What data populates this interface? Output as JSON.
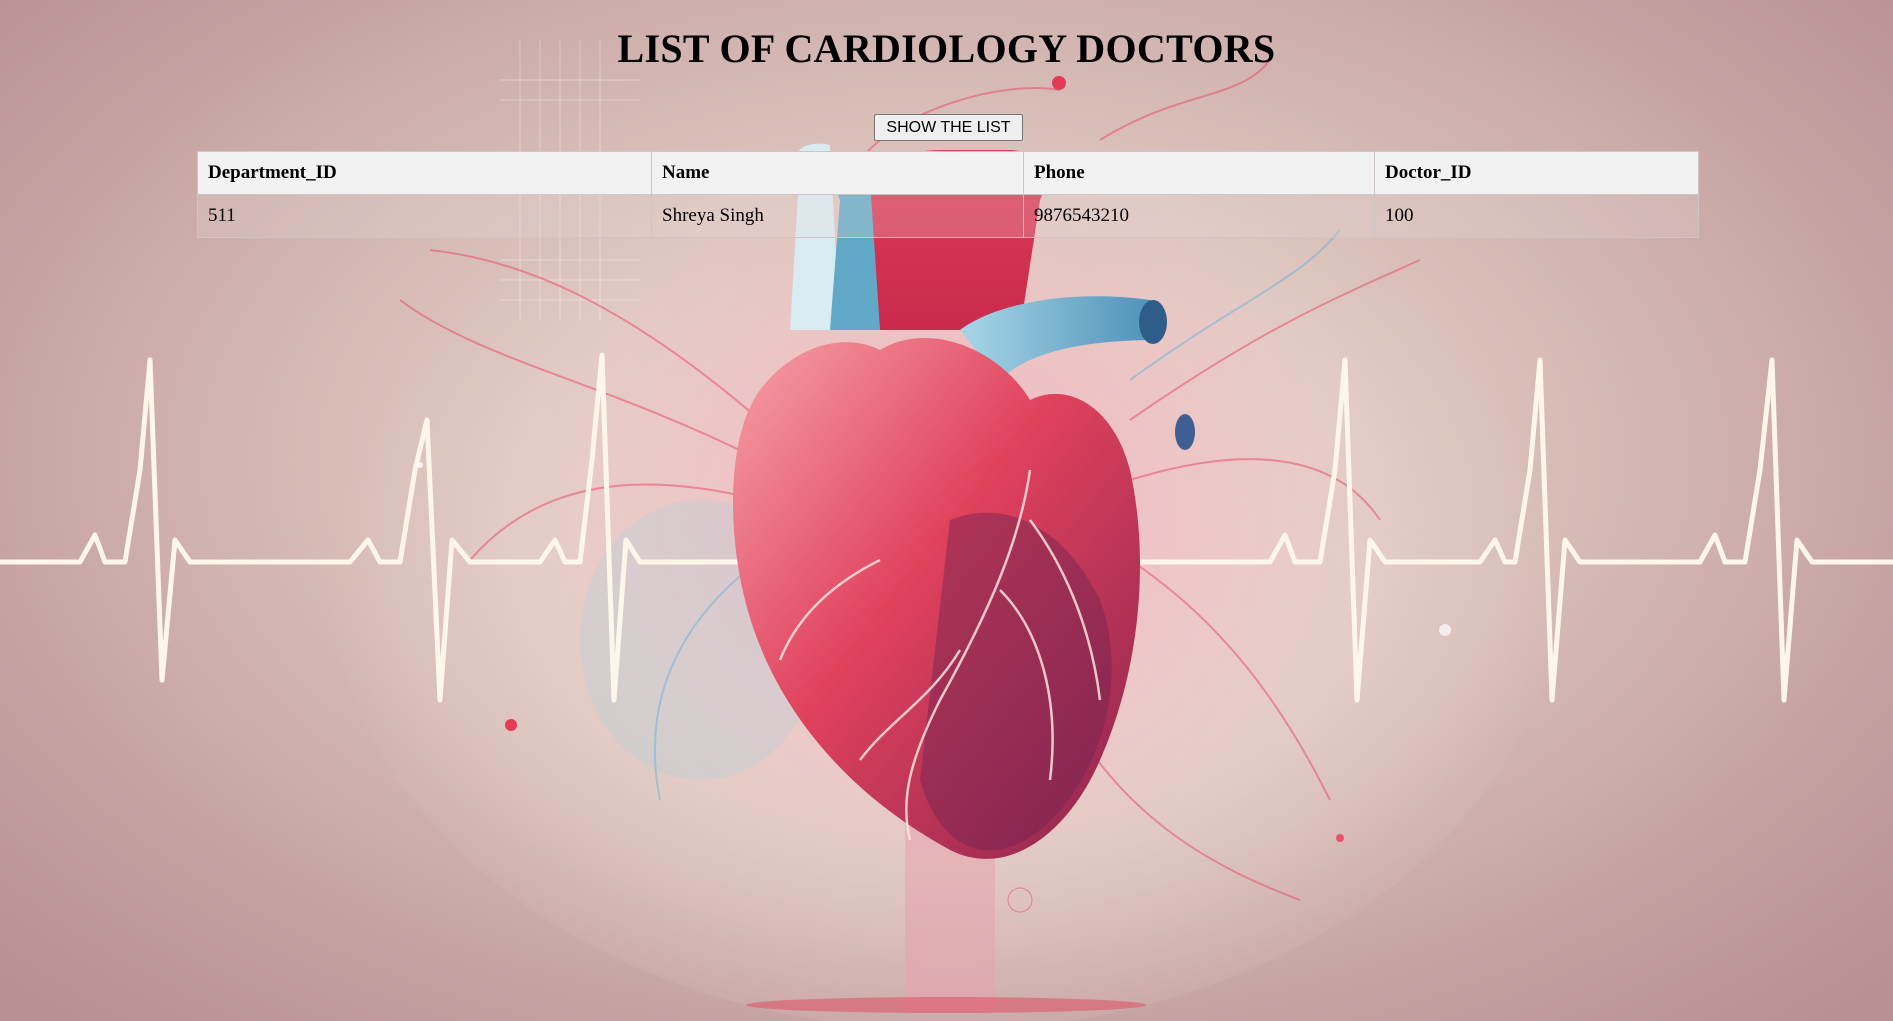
{
  "page": {
    "title": "LIST OF CARDIOLOGY DOCTORS",
    "show_button_label": "SHOW THE LIST"
  },
  "table": {
    "headers": [
      "Department_ID",
      "Name",
      "Phone",
      "Doctor_ID"
    ],
    "rows": [
      [
        "511",
        "Shreya Singh",
        "9876543210",
        "100"
      ]
    ]
  },
  "background": {
    "heart_color": "#e0415c",
    "vessel_color": "#5fa9c9",
    "pulse_line_color": "#fff6ea"
  }
}
